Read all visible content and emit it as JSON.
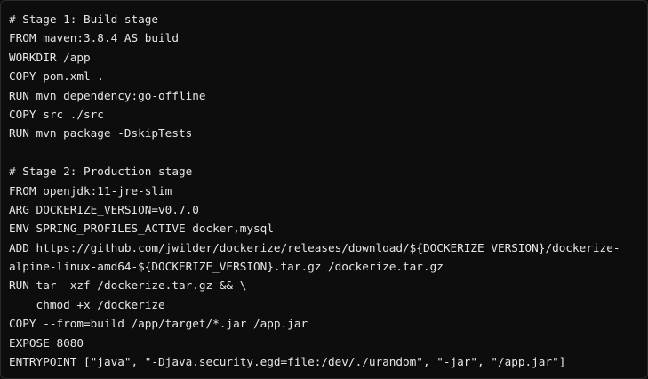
{
  "code": {
    "lines": [
      "# Stage 1: Build stage",
      "FROM maven:3.8.4 AS build",
      "WORKDIR /app",
      "COPY pom.xml .",
      "RUN mvn dependency:go-offline",
      "COPY src ./src",
      "RUN mvn package -DskipTests",
      "",
      "# Stage 2: Production stage",
      "FROM openjdk:11-jre-slim",
      "ARG DOCKERIZE_VERSION=v0.7.0",
      "ENV SPRING_PROFILES_ACTIVE docker,mysql",
      "ADD https://github.com/jwilder/dockerize/releases/download/${DOCKERIZE_VERSION}/dockerize-",
      "alpine-linux-amd64-${DOCKERIZE_VERSION}.tar.gz /dockerize.tar.gz",
      "RUN tar -xzf /dockerize.tar.gz && \\",
      "    chmod +x /dockerize",
      "COPY --from=build /app/target/*.jar /app.jar",
      "EXPOSE 8080",
      "ENTRYPOINT [\"java\", \"-Djava.security.egd=file:/dev/./urandom\", \"-jar\", \"/app.jar\"]"
    ]
  }
}
